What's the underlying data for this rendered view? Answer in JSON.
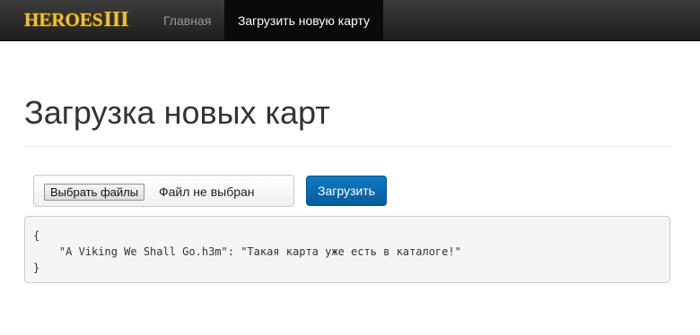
{
  "navbar": {
    "brand_text": "HEROES",
    "brand_numeral": "III",
    "items": [
      {
        "label": "Главная",
        "active": false
      },
      {
        "label": "Загрузить новую карту",
        "active": true
      }
    ]
  },
  "page": {
    "title": "Загрузка новых карт"
  },
  "upload_form": {
    "choose_file_label": "Выбрать файлы",
    "file_status": "Файл не выбран",
    "submit_label": "Загрузить"
  },
  "result": {
    "open_brace": "{",
    "entry_line": "    \"A Viking We Shall Go.h3m\": \"Такая карта уже есть в каталоге!\"",
    "close_brace": "}"
  },
  "colors": {
    "navbar_bg": "#222222",
    "brand_gold": "#e6c24a",
    "primary_button": "#0a6aae",
    "result_bg": "#f5f5f5"
  }
}
